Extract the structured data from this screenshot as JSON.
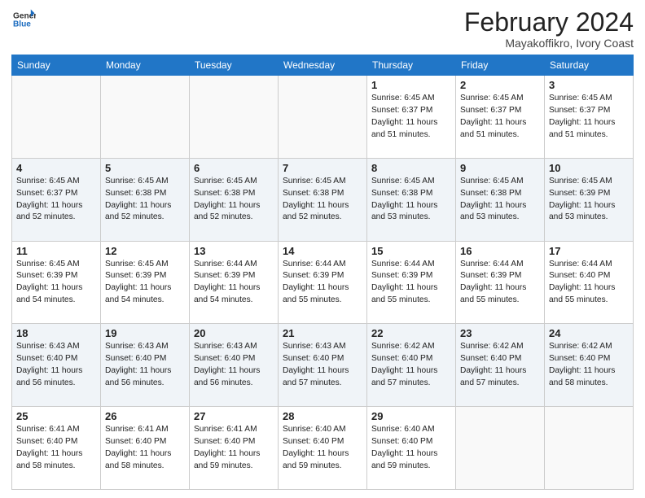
{
  "logo": {
    "general": "General",
    "blue": "Blue"
  },
  "title": {
    "month": "February 2024",
    "location": "Mayakoffikro, Ivory Coast"
  },
  "weekdays": [
    "Sunday",
    "Monday",
    "Tuesday",
    "Wednesday",
    "Thursday",
    "Friday",
    "Saturday"
  ],
  "weeks": [
    [
      {
        "day": "",
        "info": ""
      },
      {
        "day": "",
        "info": ""
      },
      {
        "day": "",
        "info": ""
      },
      {
        "day": "",
        "info": ""
      },
      {
        "day": "1",
        "info": "Sunrise: 6:45 AM\nSunset: 6:37 PM\nDaylight: 11 hours\nand 51 minutes."
      },
      {
        "day": "2",
        "info": "Sunrise: 6:45 AM\nSunset: 6:37 PM\nDaylight: 11 hours\nand 51 minutes."
      },
      {
        "day": "3",
        "info": "Sunrise: 6:45 AM\nSunset: 6:37 PM\nDaylight: 11 hours\nand 51 minutes."
      }
    ],
    [
      {
        "day": "4",
        "info": "Sunrise: 6:45 AM\nSunset: 6:37 PM\nDaylight: 11 hours\nand 52 minutes."
      },
      {
        "day": "5",
        "info": "Sunrise: 6:45 AM\nSunset: 6:38 PM\nDaylight: 11 hours\nand 52 minutes."
      },
      {
        "day": "6",
        "info": "Sunrise: 6:45 AM\nSunset: 6:38 PM\nDaylight: 11 hours\nand 52 minutes."
      },
      {
        "day": "7",
        "info": "Sunrise: 6:45 AM\nSunset: 6:38 PM\nDaylight: 11 hours\nand 52 minutes."
      },
      {
        "day": "8",
        "info": "Sunrise: 6:45 AM\nSunset: 6:38 PM\nDaylight: 11 hours\nand 53 minutes."
      },
      {
        "day": "9",
        "info": "Sunrise: 6:45 AM\nSunset: 6:38 PM\nDaylight: 11 hours\nand 53 minutes."
      },
      {
        "day": "10",
        "info": "Sunrise: 6:45 AM\nSunset: 6:39 PM\nDaylight: 11 hours\nand 53 minutes."
      }
    ],
    [
      {
        "day": "11",
        "info": "Sunrise: 6:45 AM\nSunset: 6:39 PM\nDaylight: 11 hours\nand 54 minutes."
      },
      {
        "day": "12",
        "info": "Sunrise: 6:45 AM\nSunset: 6:39 PM\nDaylight: 11 hours\nand 54 minutes."
      },
      {
        "day": "13",
        "info": "Sunrise: 6:44 AM\nSunset: 6:39 PM\nDaylight: 11 hours\nand 54 minutes."
      },
      {
        "day": "14",
        "info": "Sunrise: 6:44 AM\nSunset: 6:39 PM\nDaylight: 11 hours\nand 55 minutes."
      },
      {
        "day": "15",
        "info": "Sunrise: 6:44 AM\nSunset: 6:39 PM\nDaylight: 11 hours\nand 55 minutes."
      },
      {
        "day": "16",
        "info": "Sunrise: 6:44 AM\nSunset: 6:39 PM\nDaylight: 11 hours\nand 55 minutes."
      },
      {
        "day": "17",
        "info": "Sunrise: 6:44 AM\nSunset: 6:40 PM\nDaylight: 11 hours\nand 55 minutes."
      }
    ],
    [
      {
        "day": "18",
        "info": "Sunrise: 6:43 AM\nSunset: 6:40 PM\nDaylight: 11 hours\nand 56 minutes."
      },
      {
        "day": "19",
        "info": "Sunrise: 6:43 AM\nSunset: 6:40 PM\nDaylight: 11 hours\nand 56 minutes."
      },
      {
        "day": "20",
        "info": "Sunrise: 6:43 AM\nSunset: 6:40 PM\nDaylight: 11 hours\nand 56 minutes."
      },
      {
        "day": "21",
        "info": "Sunrise: 6:43 AM\nSunset: 6:40 PM\nDaylight: 11 hours\nand 57 minutes."
      },
      {
        "day": "22",
        "info": "Sunrise: 6:42 AM\nSunset: 6:40 PM\nDaylight: 11 hours\nand 57 minutes."
      },
      {
        "day": "23",
        "info": "Sunrise: 6:42 AM\nSunset: 6:40 PM\nDaylight: 11 hours\nand 57 minutes."
      },
      {
        "day": "24",
        "info": "Sunrise: 6:42 AM\nSunset: 6:40 PM\nDaylight: 11 hours\nand 58 minutes."
      }
    ],
    [
      {
        "day": "25",
        "info": "Sunrise: 6:41 AM\nSunset: 6:40 PM\nDaylight: 11 hours\nand 58 minutes."
      },
      {
        "day": "26",
        "info": "Sunrise: 6:41 AM\nSunset: 6:40 PM\nDaylight: 11 hours\nand 58 minutes."
      },
      {
        "day": "27",
        "info": "Sunrise: 6:41 AM\nSunset: 6:40 PM\nDaylight: 11 hours\nand 59 minutes."
      },
      {
        "day": "28",
        "info": "Sunrise: 6:40 AM\nSunset: 6:40 PM\nDaylight: 11 hours\nand 59 minutes."
      },
      {
        "day": "29",
        "info": "Sunrise: 6:40 AM\nSunset: 6:40 PM\nDaylight: 11 hours\nand 59 minutes."
      },
      {
        "day": "",
        "info": ""
      },
      {
        "day": "",
        "info": ""
      }
    ]
  ]
}
